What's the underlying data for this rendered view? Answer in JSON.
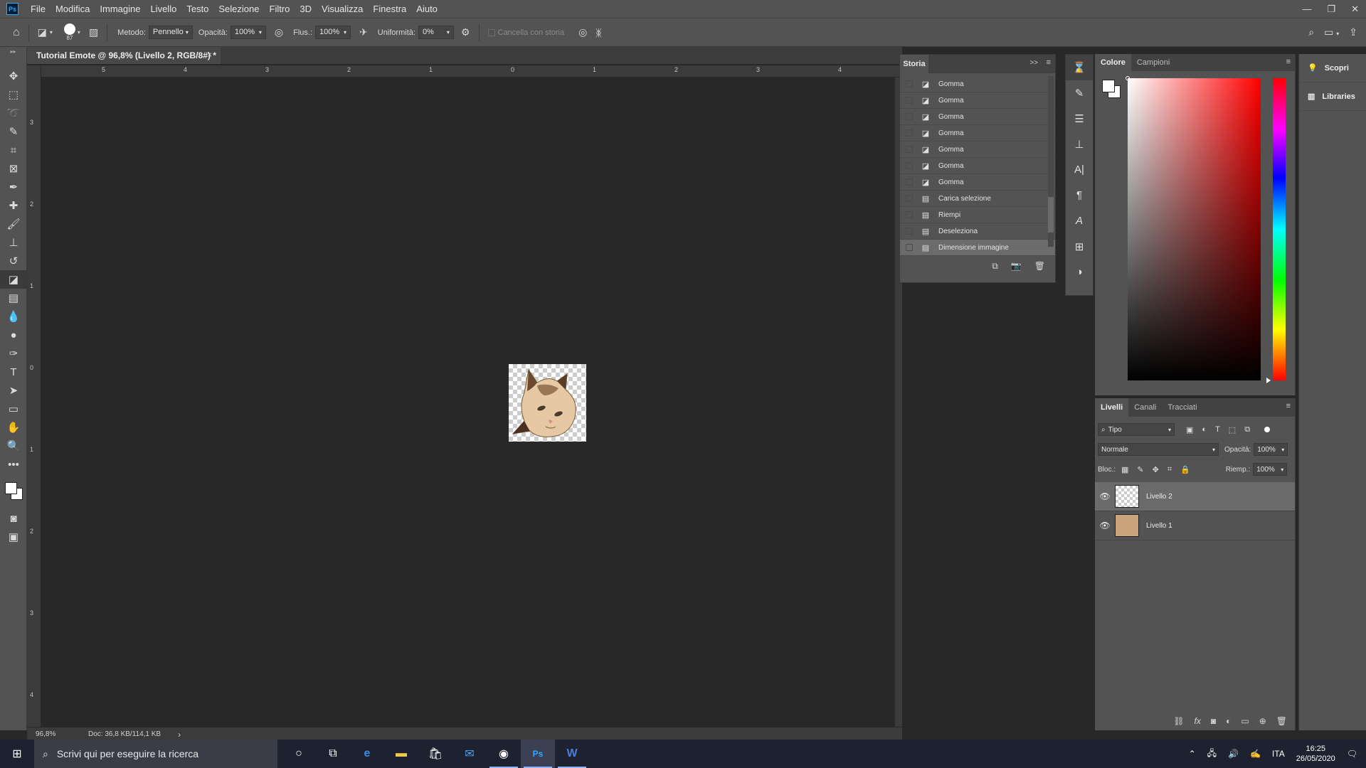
{
  "app": {
    "logo": "Ps",
    "window_controls": [
      "—",
      "❐",
      "✕"
    ]
  },
  "menu": [
    "File",
    "Modifica",
    "Immagine",
    "Livello",
    "Testo",
    "Selezione",
    "Filtro",
    "3D",
    "Visualizza",
    "Finestra",
    "Aiuto"
  ],
  "options": {
    "brush_size": "87",
    "method_label": "Metodo:",
    "method_value": "Pennello",
    "opacity_label": "Opacità:",
    "opacity_value": "100%",
    "flow_label": "Flus.:",
    "flow_value": "100%",
    "smoothing_label": "Uniformità:",
    "smoothing_value": "0%",
    "erase_history_label": "Cancella con storia"
  },
  "document": {
    "tab_title": "Tutorial Emote @ 96,8% (Livello 2, RGB/8#) *",
    "close": "×",
    "zoom": "96,8%",
    "doc_info": "Doc: 36,8 KB/114,1 KB",
    "status_arrow": "›"
  },
  "rulers": {
    "h": [
      "5",
      "4",
      "3",
      "2",
      "1",
      "0",
      "1",
      "2",
      "3",
      "4"
    ],
    "v": [
      "3",
      "2",
      "1",
      "0",
      "1",
      "2",
      "3",
      "4"
    ]
  },
  "history": {
    "tab": "Storia",
    "collapse": ">>",
    "menu": "≡",
    "items": [
      {
        "label": "Gomma",
        "icon": "eraser-icon"
      },
      {
        "label": "Gomma",
        "icon": "eraser-icon"
      },
      {
        "label": "Gomma",
        "icon": "eraser-icon"
      },
      {
        "label": "Gomma",
        "icon": "eraser-icon"
      },
      {
        "label": "Gomma",
        "icon": "eraser-icon"
      },
      {
        "label": "Gomma",
        "icon": "eraser-icon"
      },
      {
        "label": "Gomma",
        "icon": "eraser-icon"
      },
      {
        "label": "Carica selezione",
        "icon": "document-step-icon"
      },
      {
        "label": "Riempi",
        "icon": "document-step-icon"
      },
      {
        "label": "Deseleziona",
        "icon": "document-step-icon"
      },
      {
        "label": "Dimensione immagine",
        "icon": "document-step-icon",
        "selected": true
      }
    ]
  },
  "color_panel": {
    "tabs": [
      "Colore",
      "Campioni"
    ],
    "fg": "#ffffff",
    "bg": "#ffffff"
  },
  "layers_panel": {
    "tabs": [
      "Livelli",
      "Canali",
      "Tracciati"
    ],
    "filter_label": "Tipo",
    "blend_mode": "Normale",
    "opacity_label": "Opacità:",
    "opacity_value": "100%",
    "lock_label": "Bloc.:",
    "fill_label": "Riemp.:",
    "fill_value": "100%",
    "layers": [
      {
        "name": "Livello 2",
        "selected": true
      },
      {
        "name": "Livello 1",
        "selected": false
      }
    ]
  },
  "far_right": [
    {
      "label": "Scopri",
      "icon": "lightbulb-icon"
    },
    {
      "label": "Libraries",
      "icon": "libraries-icon"
    }
  ],
  "taskbar": {
    "search_placeholder": "Scrivi qui per eseguire la ricerca",
    "language": "ITA",
    "time": "16:25",
    "date": "26/05/2020"
  },
  "colors": {
    "accent_ps": "#31a8ff",
    "panel": "#535353",
    "canvas": "#282828"
  }
}
